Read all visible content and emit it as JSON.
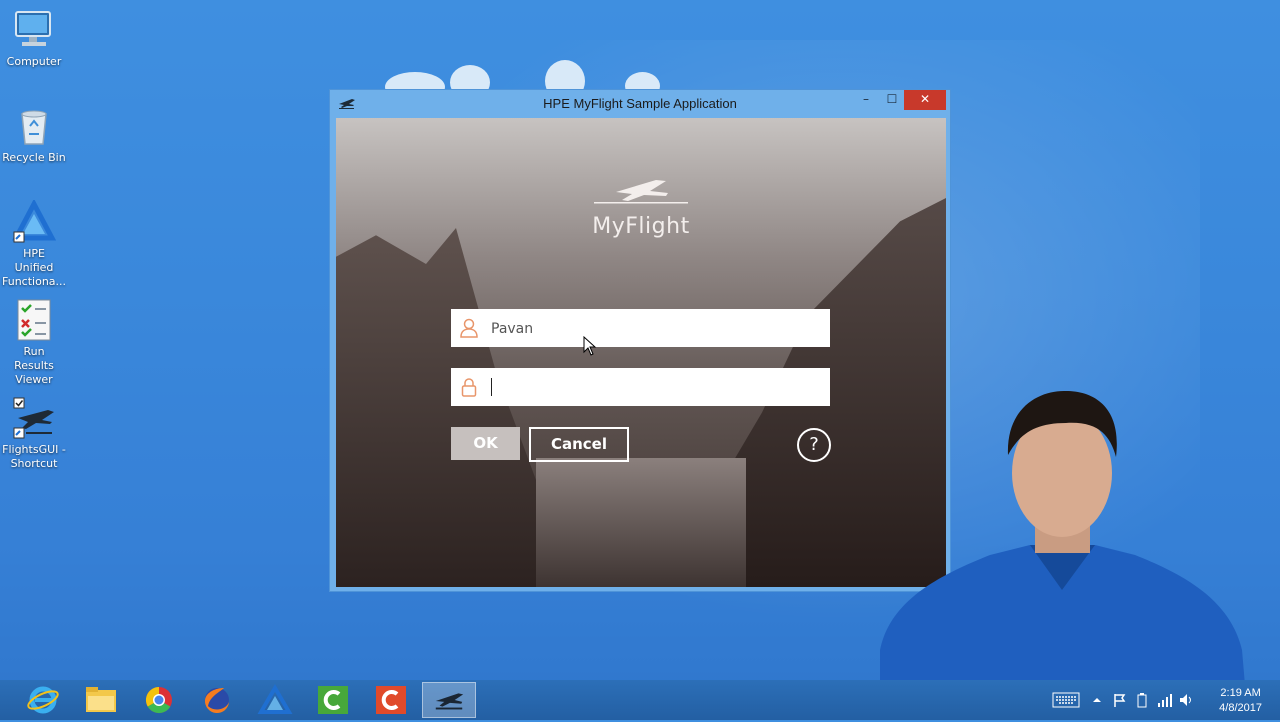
{
  "desktop": {
    "icons": [
      {
        "label": "Computer"
      },
      {
        "label": "Recycle Bin"
      },
      {
        "label": "HPE Unified Functiona..."
      },
      {
        "label": "Run Results Viewer"
      },
      {
        "label": "FlightsGUI - Shortcut"
      }
    ]
  },
  "window": {
    "title": "HPE MyFlight Sample Application",
    "controls": {
      "minimize": "–",
      "maximize": "☐",
      "close": "✕"
    }
  },
  "login": {
    "logo_text": "MyFlight",
    "username_value": "Pavan",
    "password_value": "",
    "ok_label": "OK",
    "cancel_label": "Cancel",
    "help_label": "?"
  },
  "taskbar": {
    "apps": [
      "internet-explorer-icon",
      "file-explorer-icon",
      "chrome-icon",
      "firefox-icon",
      "hpe-uft-icon",
      "camtasia-green-icon",
      "camtasia-red-icon",
      "flights-gui-icon"
    ],
    "active_app": "flights-gui-icon",
    "clock_time": "2:19 AM",
    "clock_date": "4/8/2017"
  },
  "colors": {
    "desktop_blue": "#3a88db",
    "window_frame": "#6fb0ea",
    "close_red": "#c8392b",
    "field_icon_orange": "#e8956a"
  }
}
